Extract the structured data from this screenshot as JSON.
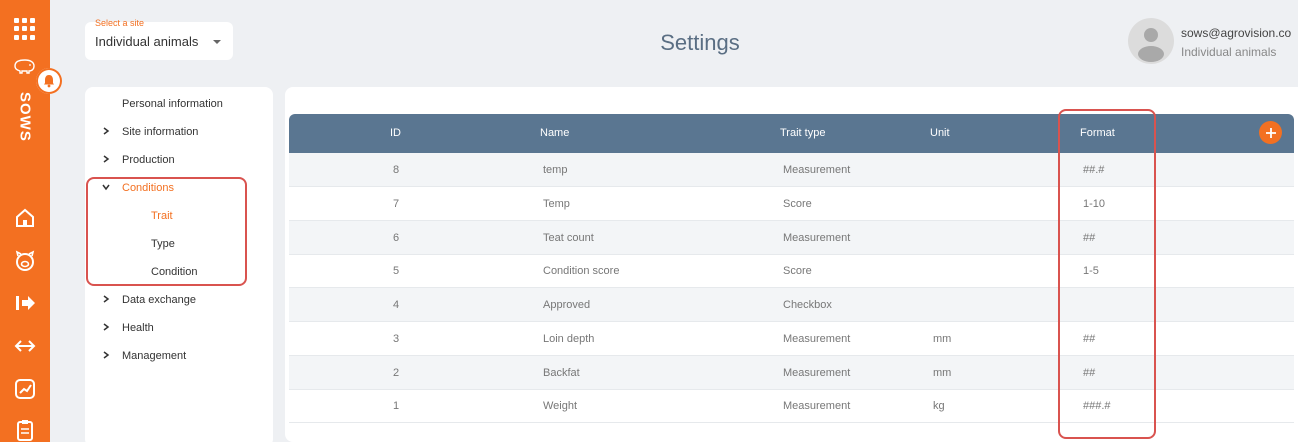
{
  "brand": "SOWS",
  "site_selector": {
    "label": "Select a site",
    "value": "Individual animals"
  },
  "page_title": "Settings",
  "user": {
    "email": "sows@agrovision.co",
    "site": "Individual animals"
  },
  "menu": {
    "personal": "Personal information",
    "site_info": "Site information",
    "production": "Production",
    "conditions": "Conditions",
    "trait": "Trait",
    "type": "Type",
    "condition": "Condition",
    "data_exchange": "Data exchange",
    "health": "Health",
    "management": "Management"
  },
  "table": {
    "headers": {
      "id": "ID",
      "name": "Name",
      "trait_type": "Trait type",
      "unit": "Unit",
      "format": "Format"
    },
    "rows": [
      {
        "id": "8",
        "name": "temp",
        "trait_type": "Measurement",
        "unit": "",
        "format": "##.#"
      },
      {
        "id": "7",
        "name": "Temp",
        "trait_type": "Score",
        "unit": "",
        "format": "1-10"
      },
      {
        "id": "6",
        "name": "Teat count",
        "trait_type": "Measurement",
        "unit": "",
        "format": "##"
      },
      {
        "id": "5",
        "name": "Condition score",
        "trait_type": "Score",
        "unit": "",
        "format": "1-5"
      },
      {
        "id": "4",
        "name": "Approved",
        "trait_type": "Checkbox",
        "unit": "",
        "format": ""
      },
      {
        "id": "3",
        "name": "Loin depth",
        "trait_type": "Measurement",
        "unit": "mm",
        "format": "##"
      },
      {
        "id": "2",
        "name": "Backfat",
        "trait_type": "Measurement",
        "unit": "mm",
        "format": "##"
      },
      {
        "id": "1",
        "name": "Weight",
        "trait_type": "Measurement",
        "unit": "kg",
        "format": "###.#"
      }
    ]
  },
  "colors": {
    "accent": "#f37021",
    "header": "#5a7691",
    "highlight": "#d9534f"
  },
  "icons": [
    "apps-grid-icon",
    "pig-icon",
    "bell-icon",
    "home-icon",
    "pig-face-icon",
    "exit-icon",
    "transfer-icon",
    "chart-icon",
    "clipboard-icon",
    "chevron-right-icon",
    "chevron-down-icon",
    "plus-icon",
    "user-avatar-icon"
  ]
}
